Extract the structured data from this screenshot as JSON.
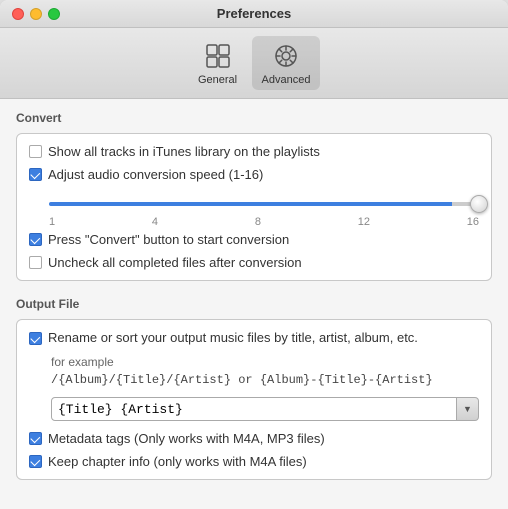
{
  "window": {
    "title": "Preferences"
  },
  "toolbar": {
    "buttons": [
      {
        "id": "general",
        "label": "General",
        "active": false
      },
      {
        "id": "advanced",
        "label": "Advanced",
        "active": true
      }
    ]
  },
  "convert_section": {
    "title": "Convert",
    "items": [
      {
        "id": "show-all-tracks",
        "label": "Show all tracks in iTunes library on the playlists",
        "checked": false
      },
      {
        "id": "adjust-audio",
        "label": "Adjust audio conversion speed (1-16)",
        "checked": true
      },
      {
        "id": "press-convert",
        "label": "Press \"Convert\" button to start conversion",
        "checked": true
      },
      {
        "id": "uncheck-completed",
        "label": "Uncheck all completed files after conversion",
        "checked": false
      }
    ],
    "slider": {
      "min": 1,
      "max": 16,
      "value": 16,
      "labels": [
        "1",
        "4",
        "8",
        "12",
        "16"
      ]
    }
  },
  "output_section": {
    "title": "Output File",
    "rename_checked": true,
    "rename_label": "Rename or sort your output music files by title, artist, album, etc.",
    "example_label": "for example",
    "example_code": "/{Album}/{Title}/{Artist} or {Album}-{Title}-{Artist}",
    "input_value": "{Title} {Artist}",
    "metadata_checked": true,
    "metadata_label": "Metadata tags (Only works with M4A, MP3 files)",
    "chapter_checked": true,
    "chapter_label": "Keep chapter info (only works with  M4A files)"
  }
}
